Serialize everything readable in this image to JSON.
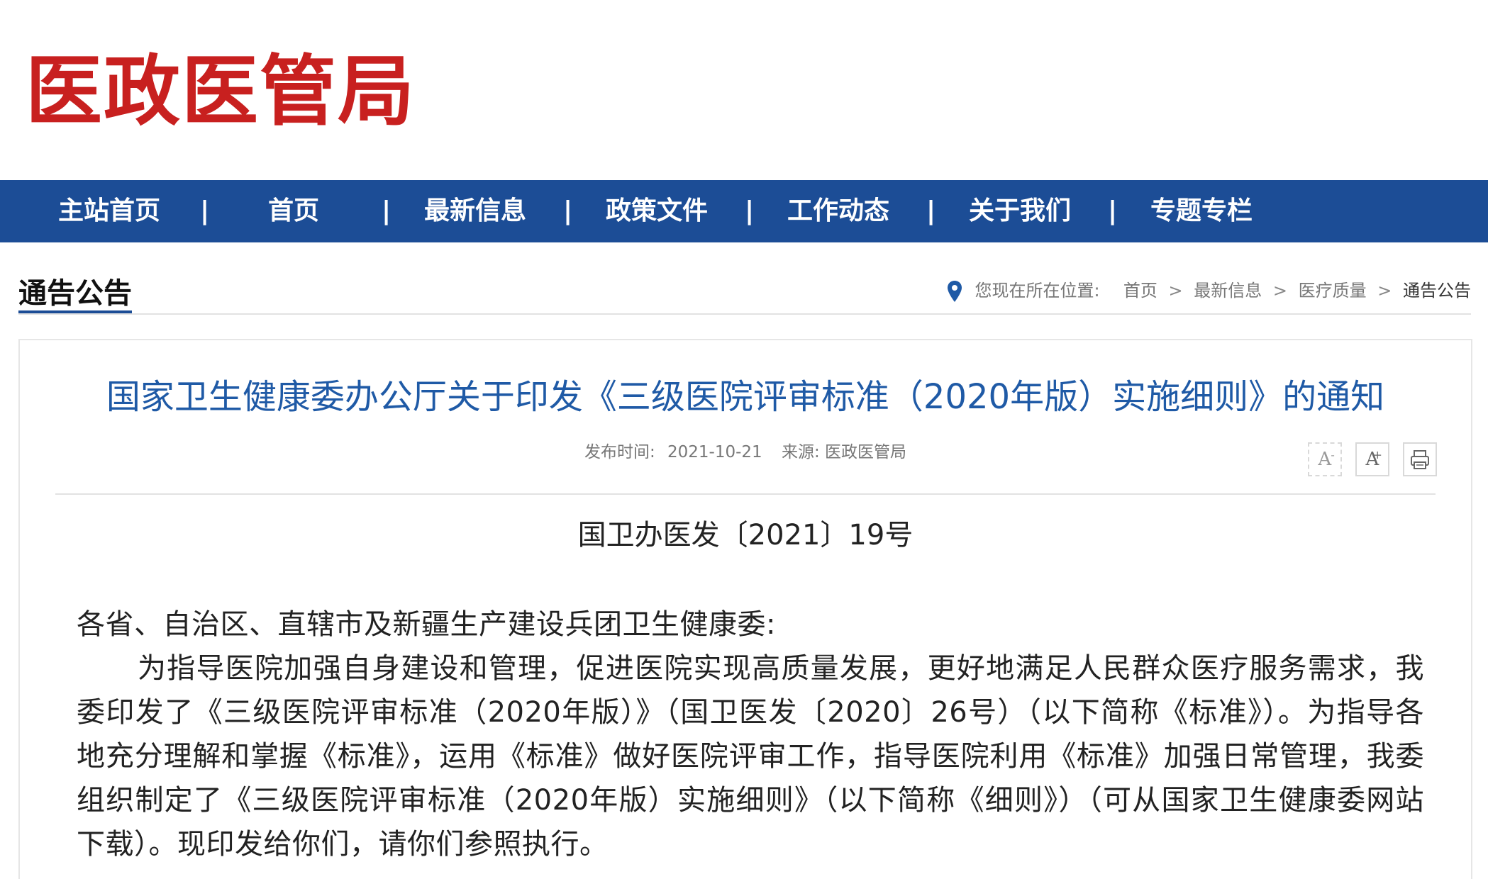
{
  "site": {
    "logo": "医政医管局"
  },
  "nav": {
    "items": [
      "主站首页",
      "首页",
      "最新信息",
      "政策文件",
      "工作动态",
      "关于我们",
      "专题专栏"
    ],
    "separator": "|"
  },
  "section": {
    "title": "通告公告"
  },
  "breadcrumb": {
    "prefix": "您现在所在位置:",
    "items": [
      "首页",
      "最新信息",
      "医疗质量",
      "通告公告"
    ],
    "separator": ">"
  },
  "article": {
    "title": "国家卫生健康委办公厅关于印发《三级医院评审标准（2020年版）实施细则》的通知",
    "publish_label": "发布时间:",
    "publish_date": "2021-10-21",
    "source": "来源: 医政医管局",
    "tools": {
      "font_smaller": "A",
      "font_smaller_mark": "-",
      "font_larger": "A",
      "font_larger_mark": "+",
      "print_icon": "printer-icon"
    },
    "doc_number": "国卫办医发〔2021〕19号",
    "salutation": "各省、自治区、直辖市及新疆生产建设兵团卫生健康委:",
    "paragraph": "为指导医院加强自身建设和管理，促进医院实现高质量发展，更好地满足人民群众医疗服务需求，我委印发了《三级医院评审标准（2020年版）》（国卫医发〔2020〕26号）（以下简称《标准》）。为指导各地充分理解和掌握《标准》，运用《标准》做好医院评审工作，指导医院利用《标准》加强日常管理，我委组织制定了《三级医院评审标准（2020年版）实施细则》（以下简称《细则》）（可从国家卫生健康委网站下载）。现印发给你们，请你们参照执行。"
  },
  "colors": {
    "nav_bg": "#1c4d96",
    "logo": "#c8201f",
    "title": "#1f5aa6"
  }
}
